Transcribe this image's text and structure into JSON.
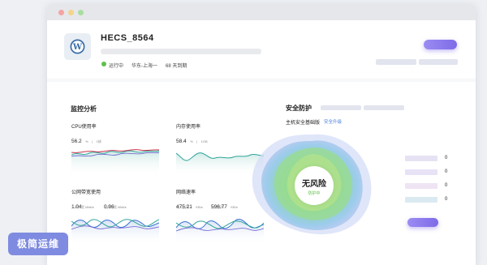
{
  "server": {
    "name": "HECS_8564",
    "status": "运行中",
    "region": "华东-上海一",
    "expiry": "68 天到期"
  },
  "monitoring": {
    "title": "监控分析",
    "cpu": {
      "label": "CPU使用率",
      "value": "56.2",
      "unit": "%",
      "extra": "1核"
    },
    "memory": {
      "label": "内存使用率",
      "value": "58.4",
      "unit": "%",
      "extra": "1GB"
    },
    "bandwidth": {
      "label": "公网带宽使用",
      "out_value": "1.04",
      "out_unit": "Mbit/s",
      "out_label": "入网带宽",
      "in_value": "0.96",
      "in_unit": "Mbit/s",
      "in_label": "出网带宽"
    },
    "network": {
      "label": "网络速率",
      "in_value": "475.21",
      "in_unit": "KB/s",
      "in_label": "流入速率",
      "out_value": "596.77",
      "out_unit": "KB/s",
      "out_label": "流出速率"
    }
  },
  "security": {
    "title": "安全防护",
    "edition": "主机安全基础版",
    "upgrade": "安全升级",
    "risk": "无风险",
    "protecting": "防护中",
    "counts": [
      "0",
      "0",
      "0",
      "0"
    ],
    "legend_colors": [
      "#e6e2f4",
      "#e7e2f6",
      "#efe4f3",
      "#dbeaf1"
    ]
  },
  "badge": "极简运维",
  "colors": {
    "status_green": "#5cc24a",
    "accent_purple": "#8674ec",
    "line_teal": "#2fa59a",
    "line_red": "#c8324a",
    "line_purple": "#6a5bcf",
    "line_blue": "#3d73d6"
  }
}
